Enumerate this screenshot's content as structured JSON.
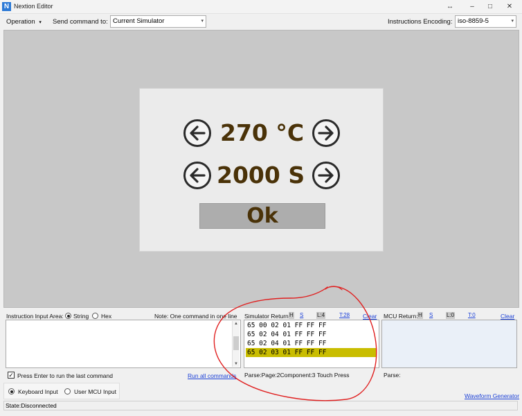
{
  "window": {
    "title": "Nextion Editor",
    "app_icon_letter": "N",
    "controls": {
      "resize": "↔",
      "minimize": "–",
      "maximize": "□",
      "close": "✕"
    }
  },
  "toolbar": {
    "operation_label": "Operation",
    "send_command_label": "Send command to:",
    "send_command_value": "Current Simulator",
    "encoding_label": "Instructions Encoding:",
    "encoding_value": "iso-8859-5",
    "dropdown_icon": "▾"
  },
  "device": {
    "temperature_value": "270 °C",
    "time_value": "2000 S",
    "ok_label": "Ok",
    "icons": [
      "arrow-left-icon",
      "arrow-right-icon"
    ]
  },
  "instruction_input": {
    "label": "Instruction Input Area:",
    "mode_string": "String",
    "mode_hex": "Hex",
    "selected_mode": "String",
    "note": "Note: One command in one line",
    "enter_checkbox_label": "Press Enter to run the last command",
    "enter_checked": true,
    "run_all_label": "Run all commands",
    "check_mark": "✓"
  },
  "input_source": {
    "keyboard_label": "Keyboard Input",
    "mcu_label": "User MCU Input",
    "selected": "Keyboard Input"
  },
  "simulator_return": {
    "label": "Simulator Return:",
    "buttons": {
      "h": "H",
      "s": "S",
      "l": "L:4",
      "t": "T:28"
    },
    "clear_label": "Clear",
    "lines": [
      "65 00 02 01 FF FF FF",
      "65 02 04 01 FF FF FF",
      "65 02 04 01 FF FF FF",
      "65 02 03 01 FF FF FF"
    ],
    "selected_line": 3,
    "parse_text": "Parse:Page:2Component:3 Touch Press"
  },
  "mcu_return": {
    "label": "MCU Return:",
    "buttons": {
      "h": "H",
      "s": "S",
      "l": "L:0",
      "t": "T:0"
    },
    "clear_label": "Clear",
    "parse_text": "Parse:",
    "waveform_label": "Waveform Generator"
  },
  "status": {
    "text": "State:Disconnected"
  },
  "colors": {
    "selected_line": "#c9bd00",
    "link": "#1a3fd6",
    "device_text": "#4a3208",
    "annotation": "#e02020"
  }
}
